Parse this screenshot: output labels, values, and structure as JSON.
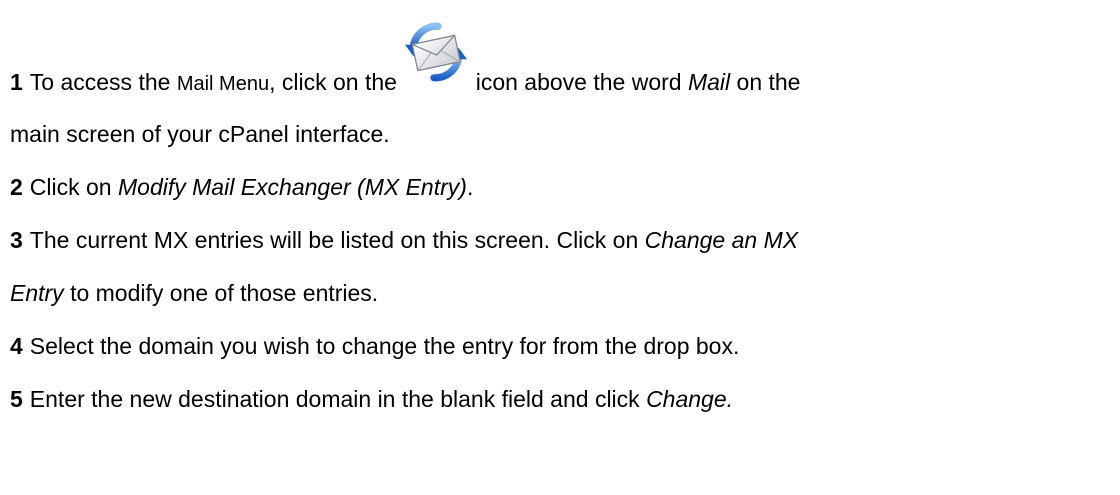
{
  "steps": [
    {
      "number": "1",
      "line1": {
        "pre": "To access the ",
        "small": "Mail Menu",
        "mid": ", click on the ",
        "post": " icon above the word ",
        "italic": "Mail",
        "end": " on the"
      },
      "line2": "main screen of your cPanel interface.",
      "icon": "mail-icon"
    },
    {
      "number": "2",
      "pre": "Click on ",
      "italic": "Modify Mail Exchanger (MX Entry)",
      "end": "."
    },
    {
      "number": "3",
      "line1": {
        "pre": "The current MX entries will be listed on this screen. Click on ",
        "italic": "Change an MX"
      },
      "line2": {
        "italic": "Entry",
        "end": " to modify one of those entries."
      }
    },
    {
      "number": "4",
      "text": "Select the domain you wish to change the entry for from the drop box."
    },
    {
      "number": "5",
      "pre": "Enter the new destination domain in the blank field and click ",
      "italic": "Change."
    }
  ]
}
